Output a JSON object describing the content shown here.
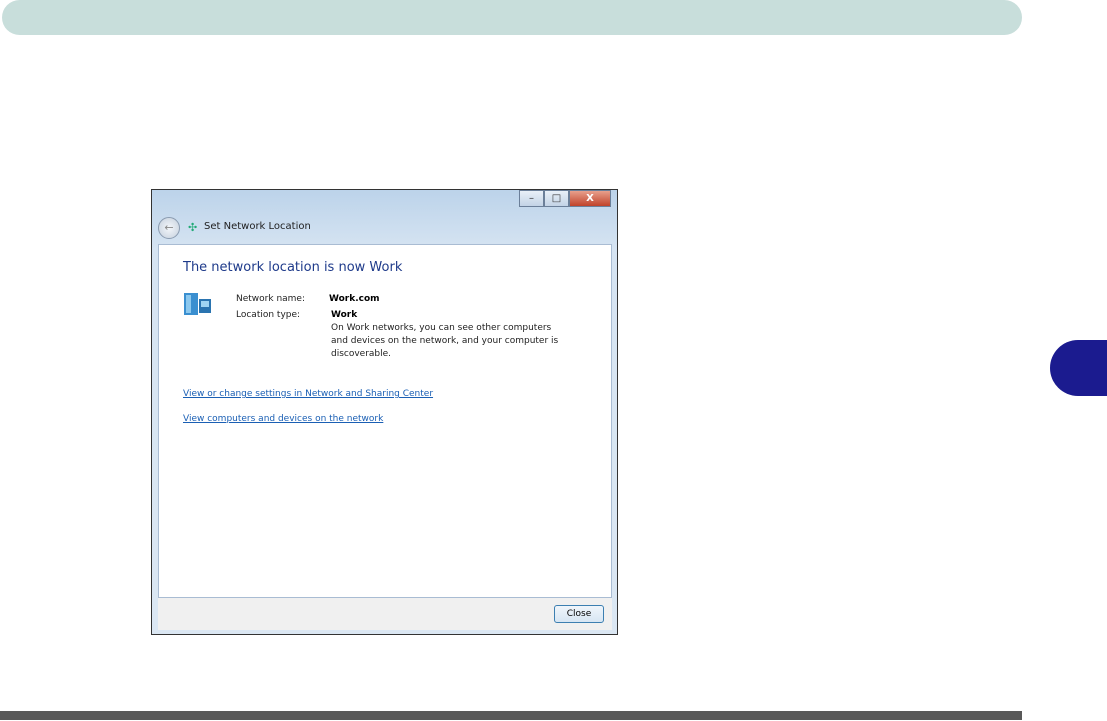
{
  "window": {
    "title": "Set Network Location",
    "controls": {
      "minimize": "–",
      "maximize": "□",
      "close": "X"
    }
  },
  "content": {
    "heading": "The network location is now Work",
    "network_name_label": "Network name:",
    "network_name_value": "Work.com",
    "location_type_label": "Location type:",
    "location_type_value": "Work",
    "description": "On Work networks, you can see other computers and devices on the network, and your computer is discoverable.",
    "links": [
      "View or change settings in Network and Sharing Center",
      "View computers and devices on the network"
    ]
  },
  "footer": {
    "close_label": "Close"
  },
  "colors": {
    "banner": "#c8dedb",
    "tab": "#1b1b8f",
    "footer_bar": "#595959"
  }
}
